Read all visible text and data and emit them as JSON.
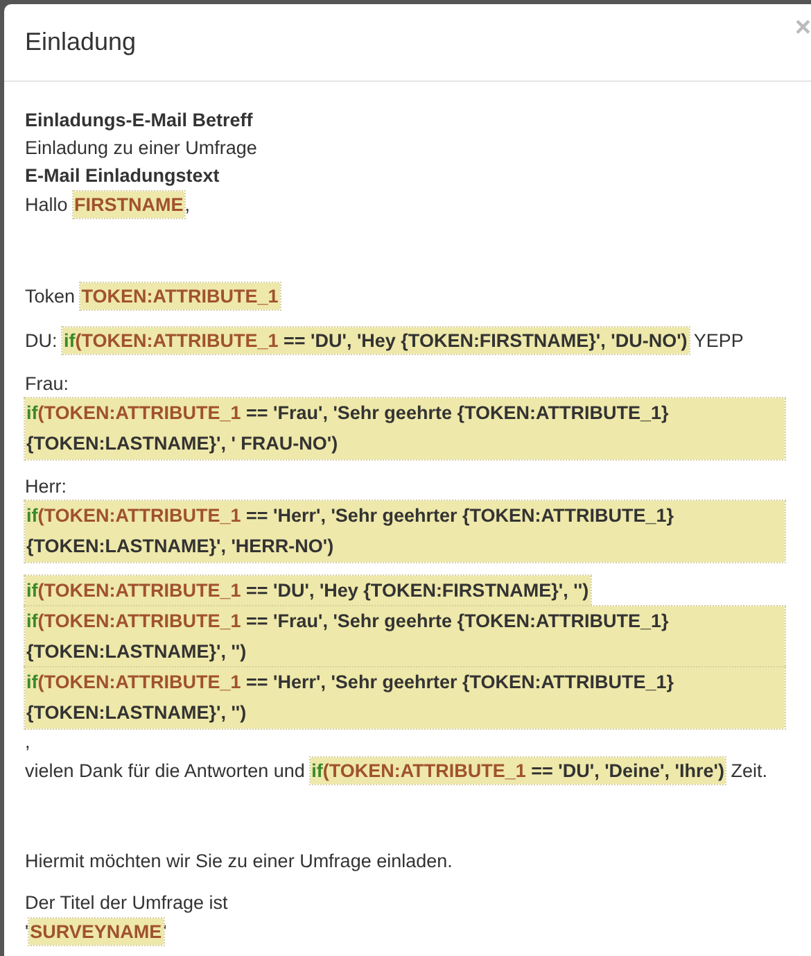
{
  "dialog": {
    "title": "Einladung",
    "close": "×"
  },
  "paragraphs": [
    {
      "lines": [
        [
          {
            "kind": "bold",
            "text": "Einladungs-E-Mail Betreff"
          }
        ],
        [
          {
            "kind": "text",
            "text": "Einladung zu einer Umfrage"
          }
        ],
        [
          {
            "kind": "bold",
            "text": "E-Mail Einladungstext"
          }
        ],
        [
          {
            "kind": "text",
            "text": "Hallo "
          },
          {
            "kind": "expr",
            "parts": [
              {
                "kind": "field",
                "text": "FIRSTNAME"
              }
            ]
          },
          {
            "kind": "text",
            "text": ","
          }
        ]
      ]
    },
    {
      "lines": [
        [
          {
            "kind": "text",
            "text": "Token "
          },
          {
            "kind": "expr",
            "parts": [
              {
                "kind": "field",
                "text": "TOKEN:ATTRIBUTE_1"
              }
            ]
          }
        ]
      ]
    },
    {
      "lines": [
        [
          {
            "kind": "text",
            "text": "DU: "
          },
          {
            "kind": "expr",
            "parts": [
              {
                "kind": "keyword",
                "text": "if"
              },
              {
                "kind": "field",
                "text": "(TOKEN:ATTRIBUTE_1"
              },
              {
                "kind": "code",
                "text": " == 'DU', 'Hey {TOKEN:FIRSTNAME}', 'DU-NO')"
              }
            ]
          },
          {
            "kind": "text",
            "text": " YEPP"
          }
        ]
      ]
    },
    {
      "lines": [
        [
          {
            "kind": "text",
            "text": "Frau:"
          }
        ],
        [
          {
            "kind": "expr",
            "parts": [
              {
                "kind": "keyword",
                "text": "if"
              },
              {
                "kind": "field",
                "text": "(TOKEN:ATTRIBUTE_1"
              },
              {
                "kind": "code",
                "text": " == 'Frau', 'Sehr geehrte {TOKEN:ATTRIBUTE_1} {TOKEN:LASTNAME}', ' FRAU-NO')"
              }
            ]
          }
        ]
      ]
    },
    {
      "lines": [
        [
          {
            "kind": "text",
            "text": "Herr:"
          }
        ],
        [
          {
            "kind": "expr",
            "parts": [
              {
                "kind": "keyword",
                "text": "if"
              },
              {
                "kind": "field",
                "text": "(TOKEN:ATTRIBUTE_1"
              },
              {
                "kind": "code",
                "text": " == 'Herr', 'Sehr geehrter {TOKEN:ATTRIBUTE_1} {TOKEN:LASTNAME}', 'HERR-NO')"
              }
            ]
          }
        ]
      ]
    },
    {
      "lines": [
        [
          {
            "kind": "expr",
            "parts": [
              {
                "kind": "keyword",
                "text": "if"
              },
              {
                "kind": "field",
                "text": "(TOKEN:ATTRIBUTE_1"
              },
              {
                "kind": "code",
                "text": " == 'DU', 'Hey {TOKEN:FIRSTNAME}', '')"
              }
            ]
          }
        ],
        [
          {
            "kind": "expr",
            "parts": [
              {
                "kind": "keyword",
                "text": "if"
              },
              {
                "kind": "field",
                "text": "(TOKEN:ATTRIBUTE_1"
              },
              {
                "kind": "code",
                "text": " == 'Frau', 'Sehr geehrte {TOKEN:ATTRIBUTE_1} {TOKEN:LASTNAME}', '')"
              }
            ]
          }
        ],
        [
          {
            "kind": "expr",
            "parts": [
              {
                "kind": "keyword",
                "text": "if"
              },
              {
                "kind": "field",
                "text": "(TOKEN:ATTRIBUTE_1"
              },
              {
                "kind": "code",
                "text": " == 'Herr', 'Sehr geehrter {TOKEN:ATTRIBUTE_1} {TOKEN:LASTNAME}', '')"
              }
            ]
          }
        ],
        [
          {
            "kind": "text",
            "text": ","
          }
        ],
        [
          {
            "kind": "text",
            "text": "vielen Dank für die Antworten und "
          },
          {
            "kind": "expr",
            "parts": [
              {
                "kind": "keyword",
                "text": "if"
              },
              {
                "kind": "field",
                "text": "(TOKEN:ATTRIBUTE_1"
              },
              {
                "kind": "code",
                "text": " == 'DU', 'Deine', 'Ihre')"
              }
            ]
          },
          {
            "kind": "text",
            "text": " Zeit."
          }
        ]
      ]
    },
    {
      "lines": [
        [
          {
            "kind": "text",
            "text": "Hiermit möchten wir Sie zu einer Umfrage einladen."
          }
        ]
      ]
    },
    {
      "lines": [
        [
          {
            "kind": "text",
            "text": "Der Titel der Umfrage ist"
          }
        ],
        [
          {
            "kind": "text",
            "text": "'"
          },
          {
            "kind": "expr",
            "parts": [
              {
                "kind": "field",
                "text": "SURVEYNAME"
              }
            ]
          },
          {
            "kind": "text",
            "text": "'"
          }
        ]
      ]
    }
  ]
}
